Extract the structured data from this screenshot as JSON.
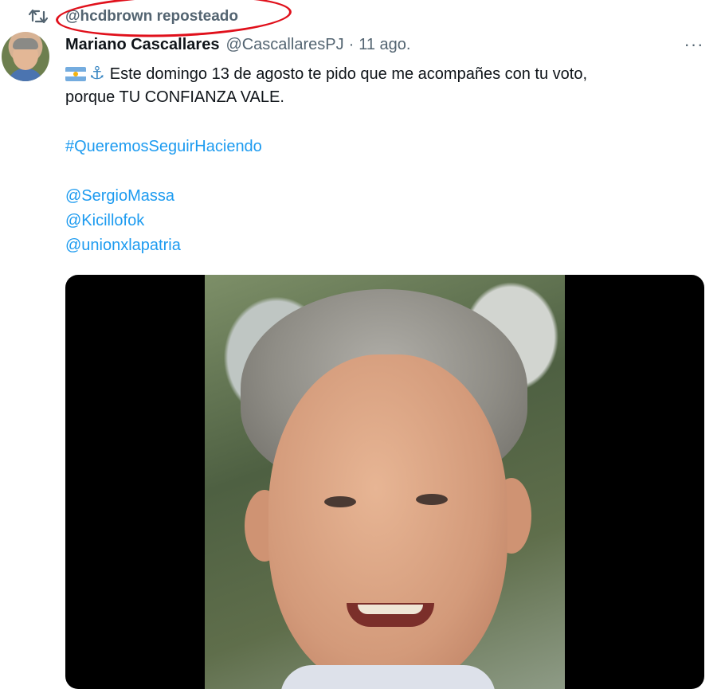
{
  "repost": {
    "label": "@hcdbrown reposteado",
    "icon": "repost-icon"
  },
  "tweet": {
    "author": {
      "display_name": "Mariano Cascallares",
      "handle": "@CascallaresPJ",
      "separator": "·",
      "time": "11 ago."
    },
    "more_label": "···",
    "emojis": {
      "flag": "argentina-flag-emoji",
      "anchor": "⚓"
    },
    "text_lines": [
      "Este domingo 13 de agosto te pido que me acompañes con tu voto,",
      "porque TU CONFIANZA VALE."
    ],
    "hashtag": "#QueremosSeguirHaciendo",
    "mentions": [
      "@SergioMassa",
      "@Kicillofok",
      "@unionxlapatria"
    ]
  },
  "colors": {
    "link": "#1d9bf0",
    "secondary_text": "#536471",
    "annotation_ellipse": "#e0101b"
  }
}
